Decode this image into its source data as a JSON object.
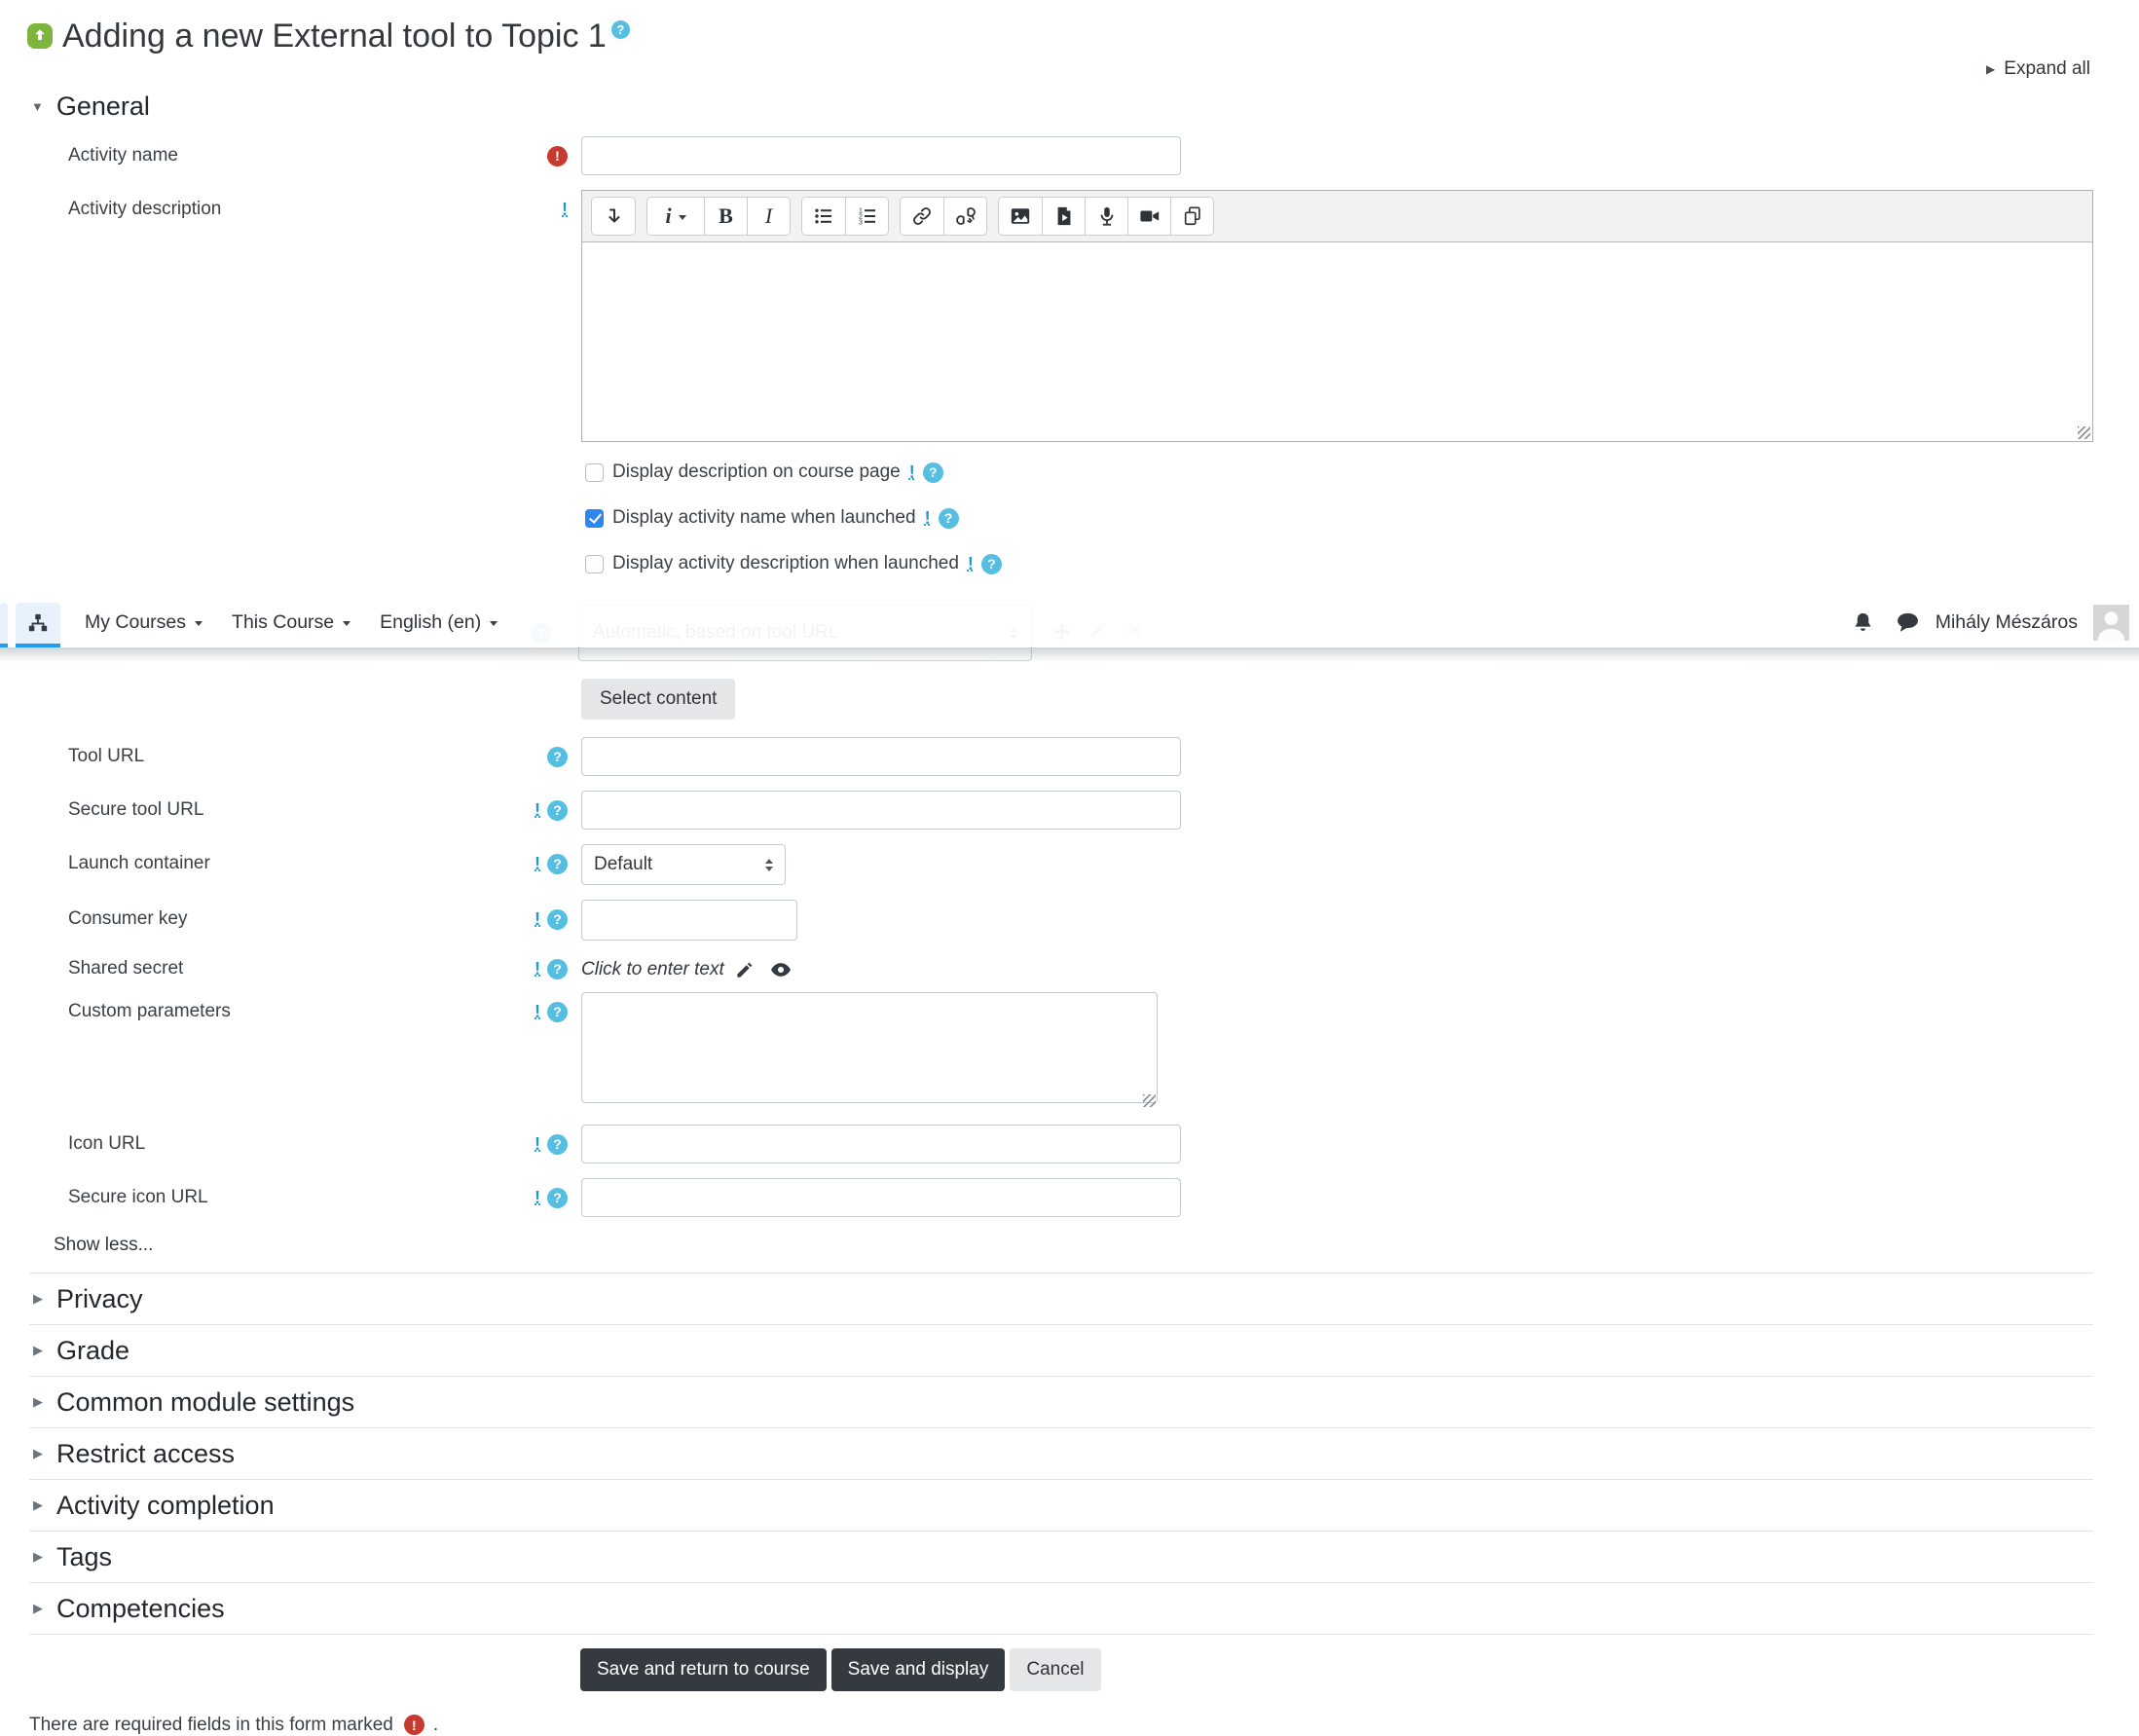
{
  "header": {
    "title": "Adding a new External tool to Topic 1",
    "expand_all": "Expand all"
  },
  "navbar": {
    "menus": [
      {
        "label": "My Courses"
      },
      {
        "label": "This Course"
      },
      {
        "label": "English (en)"
      }
    ],
    "user_name": "Mihály Mészáros"
  },
  "general": {
    "title": "General"
  },
  "fields": {
    "activity_name": {
      "label": "Activity name",
      "value": ""
    },
    "activity_description": {
      "label": "Activity description",
      "value": ""
    },
    "checkboxes": [
      {
        "label": "Display description on course page",
        "checked": false
      },
      {
        "label": "Display activity name when launched",
        "checked": true
      },
      {
        "label": "Display activity description when launched",
        "checked": false
      }
    ],
    "preconfigured_tool": {
      "select_value": "Automatic, based on tool URL",
      "select_content": "Select content"
    },
    "tool_url": {
      "label": "Tool URL",
      "value": ""
    },
    "secure_tool_url": {
      "label": "Secure tool URL",
      "value": ""
    },
    "launch_container": {
      "label": "Launch container",
      "value": "Default"
    },
    "consumer_key": {
      "label": "Consumer key",
      "value": ""
    },
    "shared_secret": {
      "label": "Shared secret",
      "value": "Click to enter text"
    },
    "custom_parameters": {
      "label": "Custom parameters",
      "value": ""
    },
    "icon_url": {
      "label": "Icon URL",
      "value": ""
    },
    "secure_icon_url": {
      "label": "Secure icon URL",
      "value": ""
    }
  },
  "show_less": "Show less...",
  "collapsed_sections": [
    {
      "label": "Privacy"
    },
    {
      "label": "Grade"
    },
    {
      "label": "Common module settings"
    },
    {
      "label": "Restrict access"
    },
    {
      "label": "Activity completion"
    },
    {
      "label": "Tags"
    },
    {
      "label": "Competencies"
    }
  ],
  "buttons": {
    "save_return": "Save and return to course",
    "save_display": "Save and display",
    "cancel": "Cancel"
  },
  "footer": {
    "required_note": "There are required fields in this form marked",
    "period": "."
  },
  "editor": {
    "toolbar_icons": [
      "collapse-toolbar",
      "paragraph-style-menu",
      "bold",
      "italic",
      "unordered-list",
      "ordered-list",
      "link",
      "unlink",
      "insert-image",
      "insert-media",
      "record-audio",
      "record-video",
      "manage-files"
    ]
  },
  "glyphs": {
    "help": "?",
    "required": "!",
    "advanced": "!",
    "expand_triangle": "▶",
    "collapse_triangle": "▼",
    "section_triangle": "▶",
    "plus": "+",
    "bold": "B",
    "italic": "I",
    "style_menu": "i"
  },
  "colors": {
    "accent_blue": "#1e9ff2",
    "checkbox_blue": "#2e86f0",
    "help_teal": "#56bee0",
    "required_red": "#c63a2f",
    "dark_button": "#343a40"
  }
}
